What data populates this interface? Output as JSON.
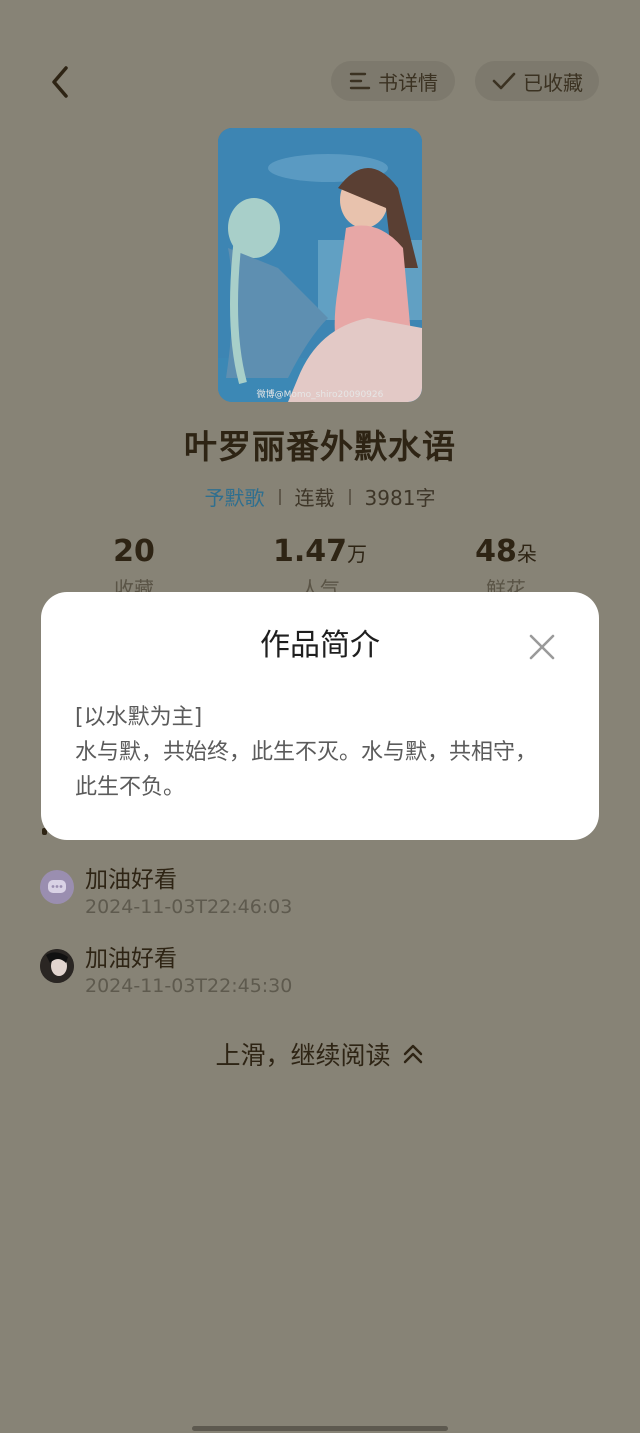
{
  "header": {
    "details_label": "书详情",
    "favorited_label": "已收藏"
  },
  "book": {
    "title": "叶罗丽番外默水语",
    "author": "予默歌",
    "status": "连载",
    "word_count": "3981字",
    "cover_watermark": "微博@Momo_shiro20090926"
  },
  "stats": [
    {
      "value": "20",
      "unit": "",
      "label": "收藏"
    },
    {
      "value": "1.47",
      "unit": "万",
      "label": "人气"
    },
    {
      "value": "48",
      "unit": "朵",
      "label": "鲜花"
    }
  ],
  "modal": {
    "title": "作品简介",
    "line1": "[以水默为主]",
    "line2": "水与默，共始终，此生不灭。水与默，共相守，此生不负。"
  },
  "comments": [
    {
      "text": "加油好看",
      "time": "2024-11-03T22:46:03"
    },
    {
      "text": "加油好看",
      "time": "2024-11-03T22:45:30"
    }
  ],
  "footer": {
    "continue_label": "上滑，继续阅读"
  }
}
